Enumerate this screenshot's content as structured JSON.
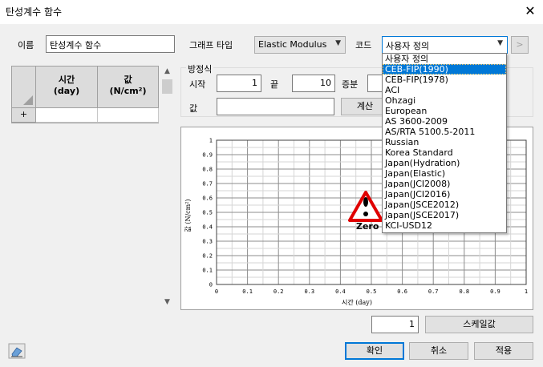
{
  "window": {
    "title": "탄성계수 함수",
    "close_label": "✕"
  },
  "name_row": {
    "name_label": "이름",
    "name_value": "탄성계수 함수",
    "graph_type_label": "그래프 타입",
    "graph_type_value": "Elastic Modulus",
    "code_label": "코드",
    "code_value": "사용자 정의",
    "next_label": ">"
  },
  "table": {
    "columns": [
      {
        "label": "시간\n(day)"
      },
      {
        "label": "값\n(N/cm²)"
      }
    ],
    "add_row_label": "+"
  },
  "equation": {
    "group_label": "방정식",
    "start_label": "시작",
    "start_value": "1",
    "end_label": "끝",
    "end_value": "10",
    "step_label": "증분",
    "value_label": "값",
    "value_input": "",
    "calc_label": "계산"
  },
  "chart_data": {
    "type": "line",
    "title": "",
    "xlabel": "시간 (day)",
    "ylabel": "값 (N/cm²)",
    "xlim": [
      0,
      1
    ],
    "ylim": [
      0,
      1
    ],
    "xticks": [
      "0",
      "0.1",
      "0.2",
      "0.3",
      "0.4",
      "0.5",
      "0.6",
      "0.7",
      "0.8",
      "0.9",
      "1"
    ],
    "yticks": [
      "0",
      "0.1",
      "0.2",
      "0.3",
      "0.4",
      "0.5",
      "0.6",
      "0.7",
      "0.8",
      "0.9",
      "1"
    ],
    "grid": true,
    "series": [],
    "warning_label": "Zero",
    "warning_icon": "warning-triangle-icon"
  },
  "dropdown": {
    "options": [
      "사용자 정의",
      "CEB-FIP(1990)",
      "CEB-FIP(1978)",
      "ACI",
      "Ohzagi",
      "European",
      "AS 3600-2009",
      "AS/RTA 5100.5-2011",
      "Russian",
      "Korea Standard",
      "Japan(Hydration)",
      "Japan(Elastic)",
      "Japan(JCI2008)",
      "Japan(JCI2016)",
      "Japan(JSCE2012)",
      "Japan(JSCE2017)",
      "KCI-USD12"
    ],
    "selected_index": 1
  },
  "footer": {
    "scale_value": "1",
    "scale_label": "스케일값",
    "ok_label": "확인",
    "cancel_label": "취소",
    "apply_label": "적용",
    "eraser_icon": "eraser-icon"
  },
  "colors": {
    "accent": "#0078d7",
    "warning_red": "#e00000"
  }
}
